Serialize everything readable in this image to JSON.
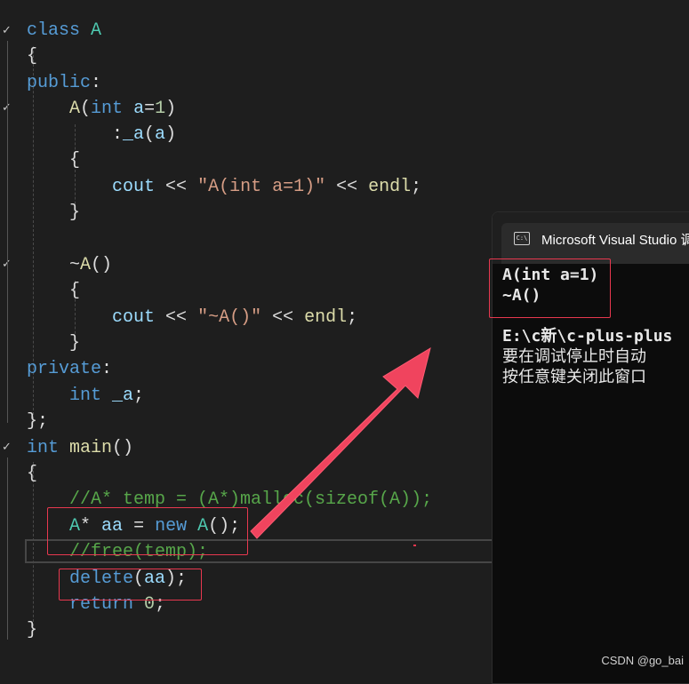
{
  "code": {
    "line1": {
      "kw": "class",
      "name": "A"
    },
    "line2": {
      "text": "{"
    },
    "line3": {
      "kw": "public",
      "colon": ":"
    },
    "line4": {
      "fn": "A",
      "open": "(",
      "kw": "int",
      "var": "a",
      "eq": "=",
      "num": "1",
      "close": ")"
    },
    "line5": {
      "colon": ":",
      "fn": "_a",
      "open": "(",
      "var": "a",
      "close": ")"
    },
    "line6": {
      "text": "{"
    },
    "line7": {
      "var": "cout",
      "op": "<<",
      "str": "\"A(int a=1)\"",
      "op2": "<<",
      "fn": "endl",
      "semi": ";"
    },
    "line8": {
      "text": "}"
    },
    "line9": {
      "tilde": "~",
      "fn": "A",
      "parens": "()"
    },
    "line10": {
      "text": "{"
    },
    "line11": {
      "var": "cout",
      "op": "<<",
      "str": "\"~A()\"",
      "op2": "<<",
      "fn": "endl",
      "semi": ";"
    },
    "line12": {
      "text": "}"
    },
    "line13": {
      "kw": "private",
      "colon": ":"
    },
    "line14": {
      "kw": "int",
      "var": "_a",
      "semi": ";"
    },
    "line15": {
      "text": "};"
    },
    "line16": {
      "kw": "int",
      "fn": "main",
      "parens": "()"
    },
    "line17": {
      "text": "{"
    },
    "line18": {
      "comment": "//A* temp = (A*)malloc(sizeof(A));"
    },
    "line19": {
      "cls": "A",
      "star": "*",
      "var": "aa",
      "eq": "=",
      "kw": "new",
      "cls2": "A",
      "parens": "();"
    },
    "line20": {
      "comment": "//free(temp);"
    },
    "line21": {
      "kw": "delete",
      "open": "(",
      "var": "aa",
      "close": ");"
    },
    "line22": {
      "kw": "return",
      "num": "0",
      "semi": ";"
    },
    "line23": {
      "text": "}"
    }
  },
  "console": {
    "title": "Microsoft Visual Studio 调",
    "icon_label": "C:\\",
    "output_line1": "A(int a=1)",
    "output_line2": "~A()",
    "path_line": "E:\\c新\\c-plus-plus",
    "msg_line1": "要在调试停止时自动",
    "msg_line2": "按任意键关闭此窗口"
  },
  "watermark": "CSDN @go_bai",
  "colors": {
    "highlight": "#e8384f",
    "arrow": "#f0445e"
  }
}
